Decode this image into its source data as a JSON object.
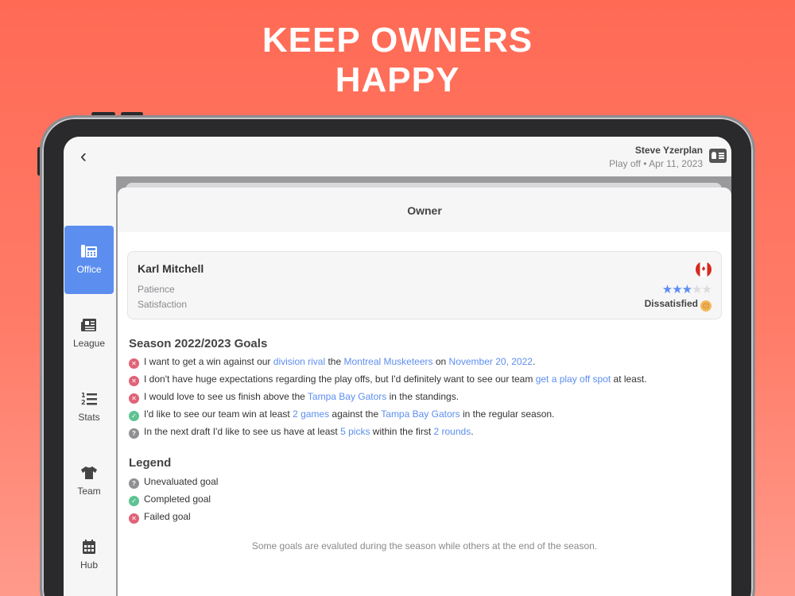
{
  "promo": {
    "line1": "KEEP OWNERS",
    "line2": "HAPPY"
  },
  "header": {
    "user_name": "Steve Yzerplan",
    "status": "Play off • Apr 11, 2023"
  },
  "sidebar": {
    "items": [
      {
        "label": "Office",
        "icon": "office-phone-icon",
        "active": true
      },
      {
        "label": "League",
        "icon": "newspaper-icon",
        "active": false
      },
      {
        "label": "Stats",
        "icon": "ordered-list-icon",
        "active": false
      },
      {
        "label": "Team",
        "icon": "jersey-icon",
        "active": false
      },
      {
        "label": "Hub",
        "icon": "calendar-icon",
        "active": false
      }
    ]
  },
  "sheet": {
    "title": "Owner"
  },
  "owner": {
    "name": "Karl Mitchell",
    "flag": "canada",
    "patience_label": "Patience",
    "satisfaction_label": "Satisfaction",
    "patience_stars": 3,
    "patience_max": 5,
    "satisfaction_value": "Dissatisfied",
    "colors": {
      "accent": "#5c8ef0",
      "fail": "#e06377",
      "done": "#5ec393",
      "pending": "#8f8f93"
    }
  },
  "goals": {
    "title": "Season 2022/2023 Goals",
    "items": [
      {
        "status": "failed",
        "parts": [
          "I want to get a win against our ",
          "division rival",
          " the ",
          "Montreal Musketeers",
          " on ",
          "November 20, 2022",
          "."
        ]
      },
      {
        "status": "failed",
        "parts": [
          "I don't have huge expectations regarding the play offs, but I'd definitely want to see our team ",
          "get a play off spot",
          " at least."
        ]
      },
      {
        "status": "failed",
        "parts": [
          "I would love to see us finish above the ",
          "Tampa Bay Gators",
          " in the standings."
        ]
      },
      {
        "status": "completed",
        "parts": [
          "I'd like to see our team win at least ",
          "2 games",
          " against the ",
          "Tampa Bay Gators",
          " in the regular season."
        ]
      },
      {
        "status": "unevaluated",
        "parts": [
          "In the next draft I'd like to see us have at least ",
          "5 picks",
          " within the first ",
          "2 rounds",
          "."
        ]
      }
    ]
  },
  "legend": {
    "title": "Legend",
    "unevaluated": "Unevaluated goal",
    "completed": "Completed goal",
    "failed": "Failed goal"
  },
  "footnote": "Some goals are evaluted during the season while others at the end of the season."
}
